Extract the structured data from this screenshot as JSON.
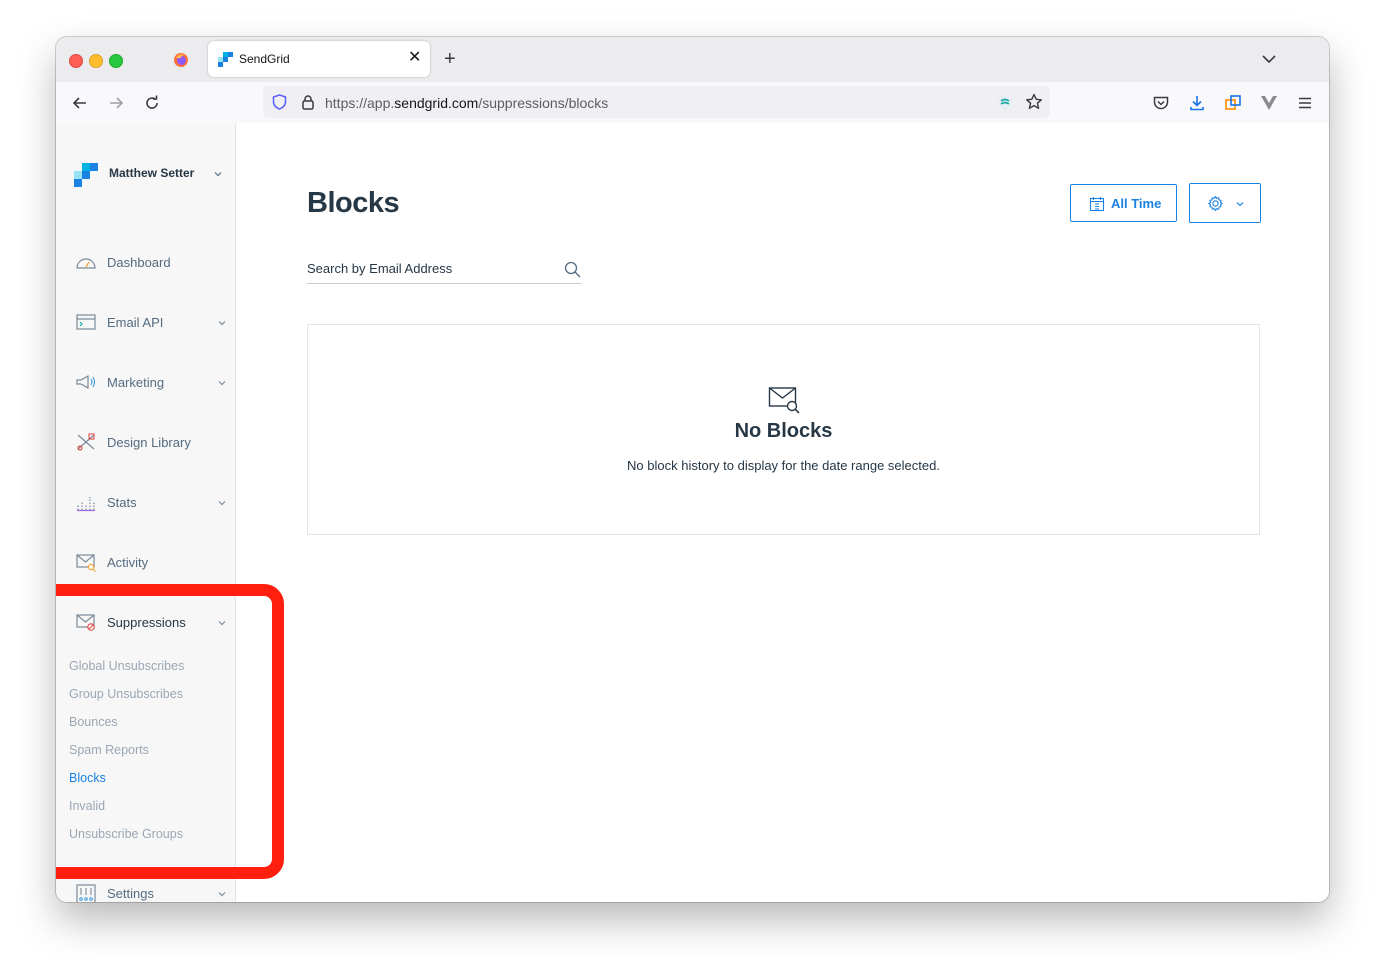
{
  "browser": {
    "tab_title": "SendGrid",
    "url_prefix": "https://app.",
    "url_domain": "sendgrid.com",
    "url_path": "/suppressions/blocks"
  },
  "account": {
    "name": "Matthew Setter"
  },
  "sidebar": {
    "items": [
      {
        "label": "Dashboard",
        "icon": "dashboard-icon"
      },
      {
        "label": "Email API",
        "icon": "email-api-icon",
        "expandable": true
      },
      {
        "label": "Marketing",
        "icon": "megaphone-icon",
        "expandable": true
      },
      {
        "label": "Design Library",
        "icon": "design-library-icon"
      },
      {
        "label": "Stats",
        "icon": "stats-icon",
        "expandable": true
      },
      {
        "label": "Activity",
        "icon": "activity-icon"
      },
      {
        "label": "Suppressions",
        "icon": "suppressions-icon",
        "expandable": true
      },
      {
        "label": "Settings",
        "icon": "settings-icon",
        "expandable": true
      }
    ],
    "suppressions_sub": [
      {
        "label": "Global Unsubscribes"
      },
      {
        "label": "Group Unsubscribes"
      },
      {
        "label": "Bounces"
      },
      {
        "label": "Spam Reports"
      },
      {
        "label": "Blocks",
        "active": true
      },
      {
        "label": "Invalid"
      },
      {
        "label": "Unsubscribe Groups"
      }
    ]
  },
  "main": {
    "title": "Blocks",
    "date_button": "All Time",
    "search_placeholder": "Search by Email Address",
    "empty_title": "No Blocks",
    "empty_text": "No block history to display for the date range selected."
  },
  "colors": {
    "accent": "#1a82e2",
    "heading": "#263746",
    "highlight": "#ff1f0f"
  }
}
